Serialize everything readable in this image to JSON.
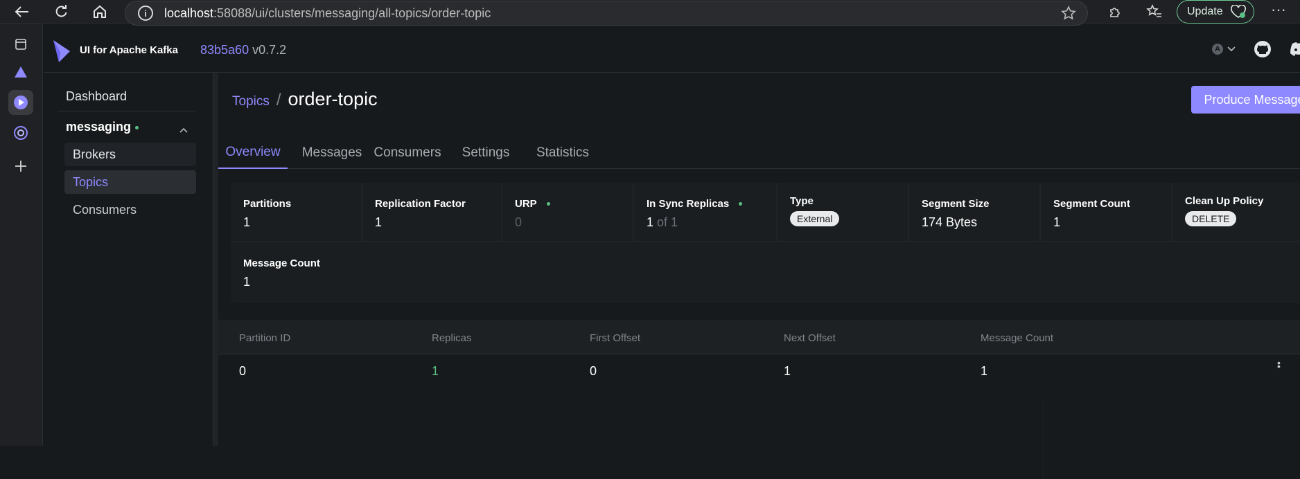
{
  "browser": {
    "url_host": "localhost",
    "url_path": ":58088/ui/clusters/messaging/all-topics/order-topic",
    "update_label": "Update"
  },
  "header": {
    "brand": "UI for Apache Kafka",
    "hash": "83b5a60",
    "version": "v0.7.2",
    "avatar_letter": "A"
  },
  "nav": {
    "dashboard": "Dashboard",
    "cluster": "messaging",
    "items": [
      "Brokers",
      "Topics",
      "Consumers"
    ]
  },
  "breadcrumb": {
    "parent": "Topics",
    "separator": "/",
    "current": "order-topic"
  },
  "actions": {
    "produce": "Produce Message"
  },
  "tabs": [
    "Overview",
    "Messages",
    "Consumers",
    "Settings",
    "Statistics"
  ],
  "stats": {
    "partitions": {
      "label": "Partitions",
      "value": "1"
    },
    "replication": {
      "label": "Replication Factor",
      "value": "1"
    },
    "urp": {
      "label": "URP",
      "value": "0"
    },
    "isr": {
      "label": "In Sync Replicas",
      "value": "1",
      "of": "of 1"
    },
    "type": {
      "label": "Type",
      "value": "External"
    },
    "segment_size": {
      "label": "Segment Size",
      "value": "174 Bytes"
    },
    "segment_count": {
      "label": "Segment Count",
      "value": "1"
    },
    "cleanup": {
      "label": "Clean Up Policy",
      "value": "DELETE"
    },
    "message_count": {
      "label": "Message Count",
      "value": "1"
    }
  },
  "table": {
    "columns": [
      "Partition ID",
      "Replicas",
      "First Offset",
      "Next Offset",
      "Message Count"
    ],
    "rows": [
      {
        "partition": "0",
        "replicas": "1",
        "first": "0",
        "next": "1",
        "count": "1"
      }
    ]
  },
  "colors": {
    "accent": "#8F89FF",
    "ok": "#5BBF85",
    "background": "#171A1C"
  }
}
